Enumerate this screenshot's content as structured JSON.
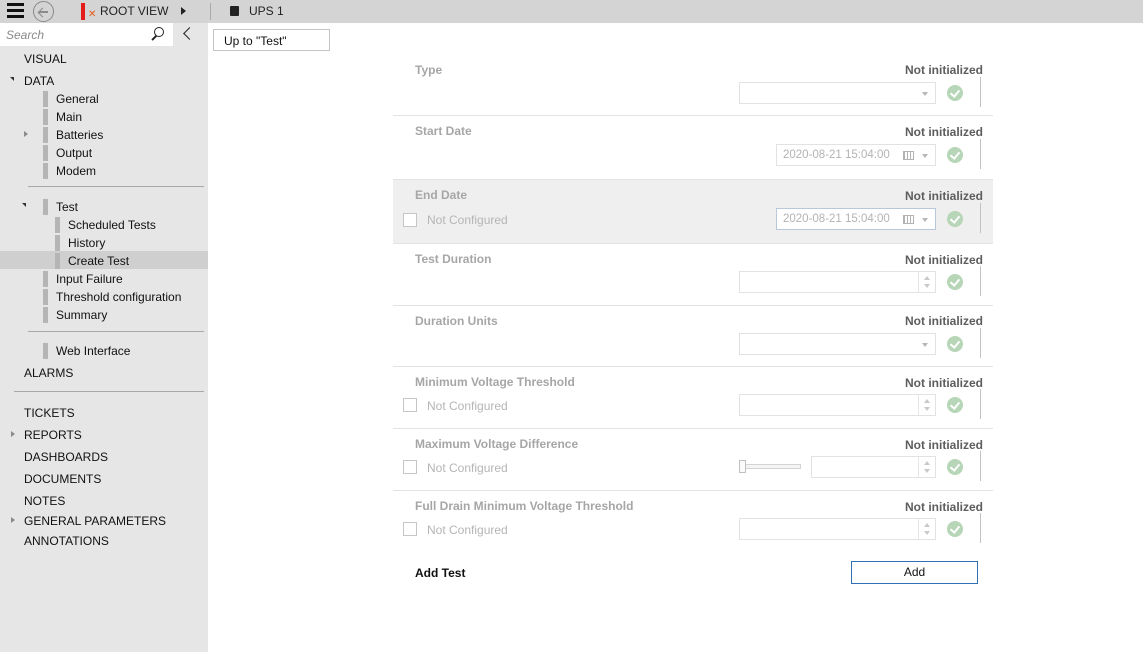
{
  "topbar": {
    "root_label": "ROOT VIEW",
    "current_label": "UPS 1"
  },
  "sidebar": {
    "search_placeholder": "Search",
    "items": {
      "visual": "VISUAL",
      "data": "DATA",
      "general": "General",
      "main": "Main",
      "batteries": "Batteries",
      "output": "Output",
      "modem": "Modem",
      "test": "Test",
      "scheduled_tests": "Scheduled Tests",
      "history": "History",
      "create_test": "Create Test",
      "input_failure": "Input Failure",
      "threshold_configuration": "Threshold configuration",
      "summary": "Summary",
      "web_interface": "Web Interface",
      "alarms": "ALARMS",
      "tickets": "TICKETS",
      "reports": "REPORTS",
      "dashboards": "DASHBOARDS",
      "documents": "DOCUMENTS",
      "notes": "NOTES",
      "general_parameters": "GENERAL PARAMETERS",
      "annotations": "ANNOTATIONS"
    }
  },
  "main": {
    "up_button": "Up to \"Test\"",
    "status_text": "Not initialized",
    "not_configured": "Not Configured",
    "fields": [
      {
        "label": "Type"
      },
      {
        "label": "Start Date",
        "value": "2020-08-21 15:04:00"
      },
      {
        "label": "End Date",
        "value": "2020-08-21 15:04:00"
      },
      {
        "label": "Test Duration"
      },
      {
        "label": "Duration Units"
      },
      {
        "label": "Minimum Voltage Threshold"
      },
      {
        "label": "Maximum Voltage Difference"
      },
      {
        "label": "Full Drain Minimum Voltage Threshold"
      }
    ],
    "add_label": "Add Test",
    "add_button": "Add"
  }
}
